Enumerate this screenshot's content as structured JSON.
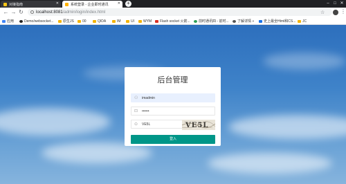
{
  "browser": {
    "tabs": [
      {
        "label": "对接指南"
      },
      {
        "label": "系统登录 - 企业即时通讯"
      }
    ],
    "url_host": "localhost:8081",
    "url_path": "/admin/login/index.html",
    "bookmarks": [
      {
        "label": "应用",
        "icon": "apps-icon"
      },
      {
        "label": "Demo/websocket...",
        "icon": "github-icon"
      },
      {
        "label": "原生JS",
        "icon": "folder-icon"
      },
      {
        "label": "00",
        "icon": "folder-icon"
      },
      {
        "label": "QIDA",
        "icon": "folder-icon"
      },
      {
        "label": "IM",
        "icon": "folder-icon"
      },
      {
        "label": "UI",
        "icon": "folder-icon"
      },
      {
        "label": "WYM",
        "icon": "folder-icon"
      },
      {
        "label": "Flash socket 火箭...",
        "icon": "red-site-icon"
      },
      {
        "label": "前时通讯四 - 前时...",
        "icon": "green-site-icon"
      },
      {
        "label": "了解详情 »",
        "icon": "globe-icon"
      },
      {
        "label": "史上最全Html和CS...",
        "icon": "blue-site-icon"
      },
      {
        "label": "JC",
        "icon": "folder-icon"
      }
    ]
  },
  "login": {
    "title": "后台管理",
    "username": "imadmin",
    "password": "••••••",
    "captcha_value": "VE5L",
    "captcha_image_text": "VE5L",
    "submit_label": "登入"
  },
  "colors": {
    "accent": "#009688",
    "autofill": "#e8f0fe"
  }
}
